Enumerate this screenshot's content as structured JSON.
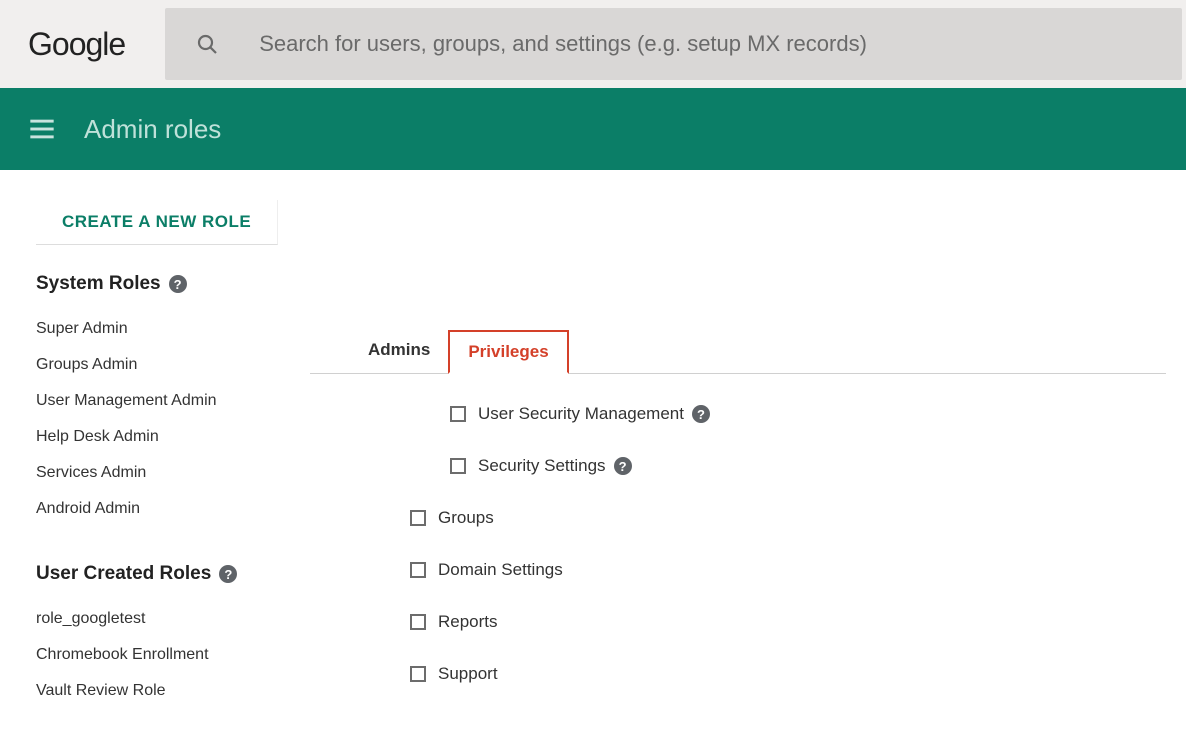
{
  "topbar": {
    "logo": "Google",
    "search_placeholder": "Search for users, groups, and settings (e.g. setup MX records)"
  },
  "header": {
    "title": "Admin roles"
  },
  "sidebar": {
    "create_label": "CREATE A NEW ROLE",
    "system_roles_heading": "System Roles",
    "system_roles": [
      "Super Admin",
      "Groups Admin",
      "User Management Admin",
      "Help Desk Admin",
      "Services Admin",
      "Android Admin"
    ],
    "user_roles_heading": "User Created Roles",
    "user_roles": [
      "role_googletest",
      "Chromebook Enrollment",
      "Vault Review Role"
    ]
  },
  "tabs": {
    "admins": "Admins",
    "privileges": "Privileges"
  },
  "privileges": [
    {
      "label": "User Security Management",
      "indent": true,
      "help": true
    },
    {
      "label": "Security Settings",
      "indent": true,
      "help": true
    },
    {
      "label": "Groups",
      "indent": false,
      "help": false
    },
    {
      "label": "Domain Settings",
      "indent": false,
      "help": false
    },
    {
      "label": "Reports",
      "indent": false,
      "help": false
    },
    {
      "label": "Support",
      "indent": false,
      "help": false
    }
  ]
}
